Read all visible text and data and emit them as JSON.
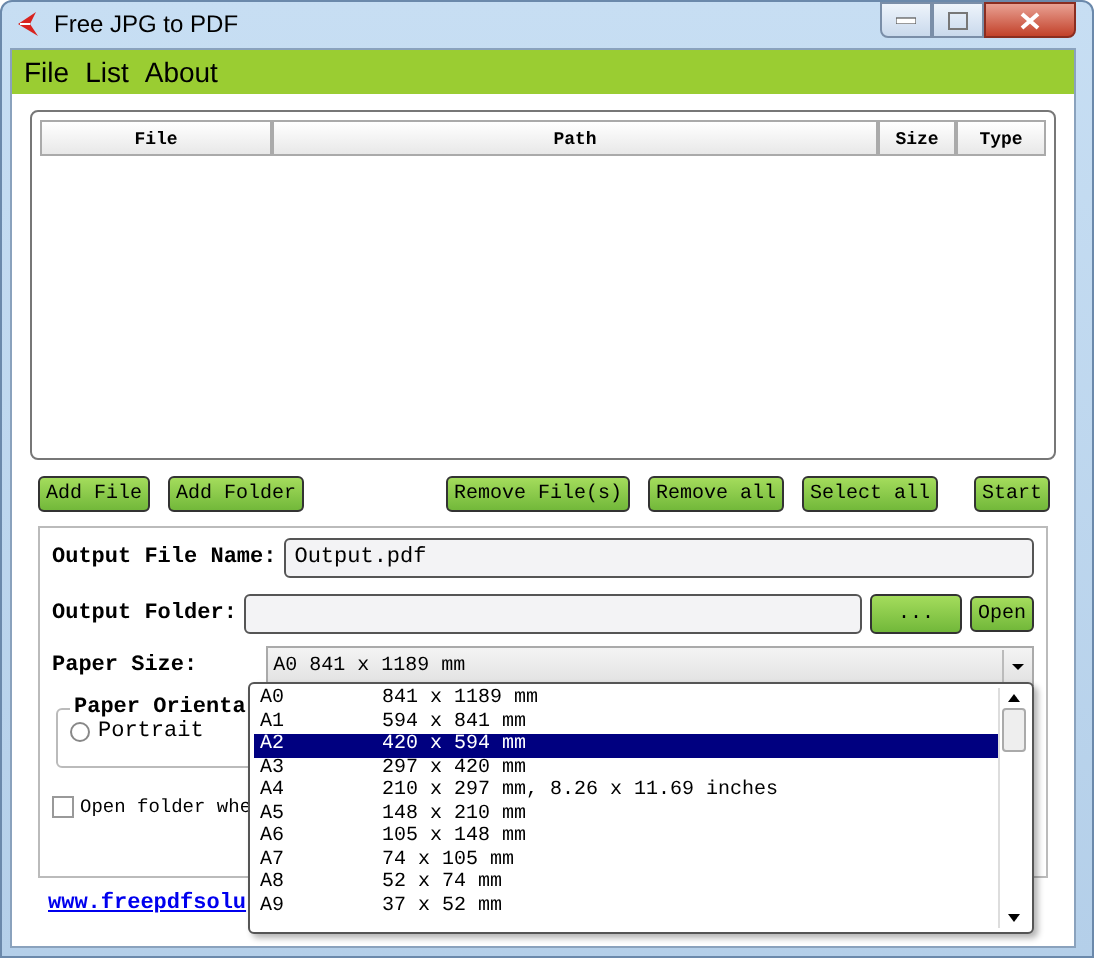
{
  "window": {
    "title": "Free JPG to PDF"
  },
  "menu": [
    {
      "label": "File"
    },
    {
      "label": "List"
    },
    {
      "label": "About"
    }
  ],
  "file_list": {
    "columns": [
      "File",
      "Path",
      "Size",
      "Type"
    ]
  },
  "list_buttons": [
    "Add File",
    "Add Folder",
    "Remove File(s)",
    "Remove all",
    "Select all"
  ],
  "start_button": "Start",
  "output_file_name": {
    "label": "Output File Name:",
    "value": "Output.pdf"
  },
  "output_folder": {
    "label": "Output Folder:",
    "browse_button": "...",
    "open_button": "Open"
  },
  "paper_size": {
    "label": "Paper Size:",
    "value": "A0 841 x 1189 mm",
    "expanded": true,
    "options": [
      {
        "name": "A0",
        "size": "841 x 1189 mm",
        "selected": false
      },
      {
        "name": "A1",
        "size": "594 x 841 mm",
        "selected": false
      },
      {
        "name": "A2",
        "size": "420 x 594 mm",
        "selected": true
      },
      {
        "name": "A3",
        "size": "297 x 420 mm",
        "selected": false
      },
      {
        "name": "A4",
        "size": "210 x 297 mm, 8.26 x 11.69 inches",
        "selected": false
      },
      {
        "name": "A5",
        "size": "148 x 210 mm",
        "selected": false
      },
      {
        "name": "A6",
        "size": "105 x 148 mm",
        "selected": false
      },
      {
        "name": "A7",
        "size": "74 x 105 mm",
        "selected": false
      },
      {
        "name": "A8",
        "size": "52 x 74 mm",
        "selected": false
      },
      {
        "name": "A9",
        "size": "37 x 52 mm",
        "selected": false
      }
    ]
  },
  "paper_orientation": {
    "title": "Paper Orienta",
    "options": [
      {
        "label": "Portrait",
        "selected": false
      }
    ]
  },
  "open_folder": {
    "label": "Open folder whe",
    "checked": false
  },
  "link": "www.freepdfsolu"
}
